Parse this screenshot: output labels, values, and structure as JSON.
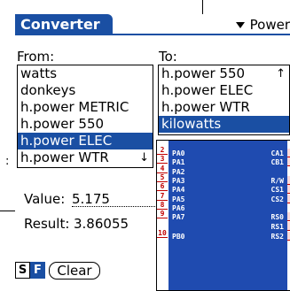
{
  "titlebar": {
    "title": "Converter",
    "category": "Power"
  },
  "from": {
    "label": "From:",
    "items": [
      "watts",
      "donkeys",
      "h.power METRIC",
      "h.power 550",
      "h.power ELEC",
      "h.power WTR"
    ],
    "selected": "h.power ELEC",
    "scroll_indicator": "↓"
  },
  "to": {
    "label": "To:",
    "items": [
      "h.power 550",
      "h.power ELEC",
      "h.power WTR",
      "kilowatts"
    ],
    "selected": "kilowatts",
    "scroll_indicator": "↑"
  },
  "value": {
    "label": "Value:",
    "amount": "5.175"
  },
  "result": {
    "label": "Result:",
    "amount": "3.86055"
  },
  "buttons": {
    "s_label": "S",
    "f_label": "F",
    "clear_label": "Clear"
  },
  "chip": {
    "left_pins": [
      "PA0",
      "PA1",
      "PA2",
      "PA3",
      "PA4",
      "PA5",
      "PA6",
      "PA7",
      "PB0"
    ],
    "left_numbers": [
      "2",
      "3",
      "4",
      "5",
      "6",
      "7",
      "8",
      "9",
      "10"
    ],
    "right_pins": [
      "CA1",
      "CB1",
      "R/W",
      "CS1",
      "CS2",
      "RS0",
      "RS1",
      "RS2"
    ]
  },
  "edge_fragment": ":"
}
